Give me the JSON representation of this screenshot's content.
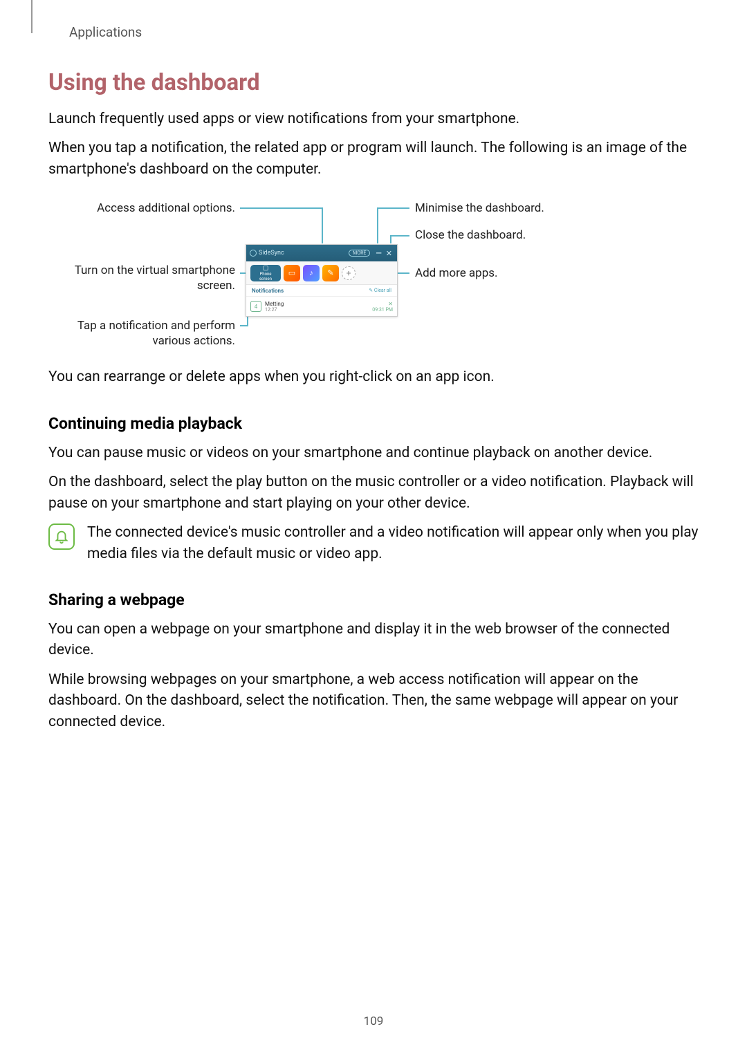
{
  "breadcrumb": "Applications",
  "section_title": "Using the dashboard",
  "intro_p1": "Launch frequently used apps or view notifications from your smartphone.",
  "intro_p2": "When you tap a notification, the related app or program will launch. The following is an image of the smartphone's dashboard on the computer.",
  "callouts": {
    "access_options": "Access additional options.",
    "virtual_phone_l1": "Turn on the virtual smartphone",
    "virtual_phone_l2": "screen.",
    "tap_notif_l1": "Tap a notification and perform",
    "tap_notif_l2": "various actions.",
    "minimise": "Minimise the dashboard.",
    "close": "Close the dashboard.",
    "add_apps": "Add more apps."
  },
  "dashboard": {
    "title": "SideSync",
    "more": "MORE",
    "minimise": "—",
    "close": "✕",
    "phone_label": "Phone",
    "phone_sub": "screen",
    "gallery_glyph": "▭",
    "music_glyph": "♪",
    "files_glyph": "✎",
    "add_glyph": "+",
    "notifications_label": "Notifications",
    "clear_all": "✎ Clear all",
    "notif_icon": "4",
    "notif_title": "Metting",
    "notif_sub": "12:27",
    "notif_x": "✕",
    "notif_time": "09:31 PM"
  },
  "after_diagram": "You can rearrange or delete apps when you right-click on an app icon.",
  "sub1_title": "Continuing media playback",
  "sub1_p1": "You can pause music or videos on your smartphone and continue playback on another device.",
  "sub1_p2": "On the dashboard, select the play button on the music controller or a video notification. Playback will pause on your smartphone and start playing on your other device.",
  "note_text": "The connected device's music controller and a video notification will appear only when you play media files via the default music or video app.",
  "sub2_title": "Sharing a webpage",
  "sub2_p1": "You can open a webpage on your smartphone and display it in the web browser of the connected device.",
  "sub2_p2": "While browsing webpages on your smartphone, a web access notification will appear on the dashboard. On the dashboard, select the notification. Then, the same webpage will appear on your connected device.",
  "page_number": "109"
}
